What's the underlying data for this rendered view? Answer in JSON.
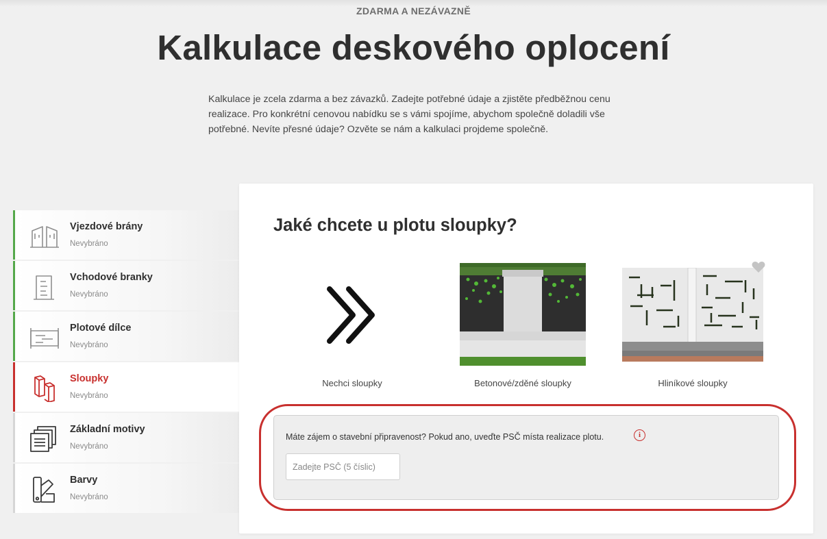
{
  "header": {
    "eyebrow": "ZDARMA A NEZÁVAZNĚ",
    "title": "Kalkulace deskového oplocení",
    "intro": "Kalkulace je zcela zdarma a bez závazků. Zadejte potřebné údaje a zjistěte předběžnou cenu realizace. Pro konkrétní cenovou nabídku se s vámi spojíme, abychom společně doladili vše potřebné. Nevíte přesné údaje? Ozvěte se nám a kalkulaci projdeme společně."
  },
  "sidebar": {
    "items": [
      {
        "label": "Vjezdové brány",
        "status": "Nevybráno",
        "icon": "driveway-gate-icon",
        "state": "done"
      },
      {
        "label": "Vchodové branky",
        "status": "Nevybráno",
        "icon": "entrance-gate-icon",
        "state": "done"
      },
      {
        "label": "Plotové dílce",
        "status": "Nevybráno",
        "icon": "fence-panel-icon",
        "state": "done"
      },
      {
        "label": "Sloupky",
        "status": "Nevybráno",
        "icon": "posts-icon",
        "state": "active"
      },
      {
        "label": "Základní motivy",
        "status": "Nevybráno",
        "icon": "motifs-icon",
        "state": "pending"
      },
      {
        "label": "Barvy",
        "status": "Nevybráno",
        "icon": "colors-icon",
        "state": "pending"
      }
    ]
  },
  "main": {
    "question": "Jaké chcete u plotu sloupky?",
    "options": [
      {
        "label": "Nechci sloupky",
        "icon": "double-chevron-right-icon"
      },
      {
        "label": "Betonové/zděné sloupky",
        "icon": "concrete-post-image"
      },
      {
        "label": "Hliníkové sloupky",
        "icon": "aluminium-post-image"
      }
    ],
    "psc": {
      "label": "Máte zájem o stavební připravenost? Pokud ano, uveďte PSČ místa realizace plotu.",
      "info_glyph": "i",
      "placeholder": "Zadejte PSČ (5 číslic)",
      "value": ""
    }
  },
  "colors": {
    "accent": "#c8302e",
    "done": "#55a84a",
    "pending": "#d6d6d6"
  }
}
